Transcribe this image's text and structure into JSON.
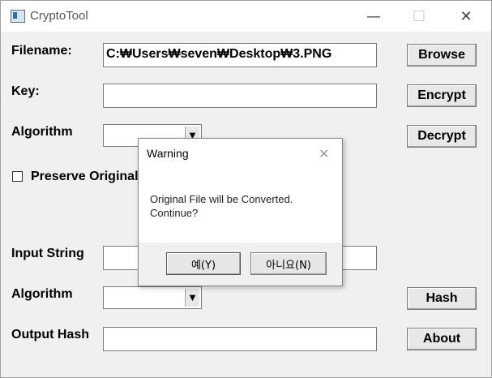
{
  "window": {
    "title": "CryptoTool",
    "minimize": "—",
    "maximize": "☐",
    "close": "✕"
  },
  "form": {
    "filename_label": "Filename:",
    "filename_value": "C:₩Users₩seven₩Desktop₩3.PNG",
    "key_label": "Key:",
    "key_value": "",
    "algorithm_label": "Algorithm",
    "preserve_label": "Preserve Original",
    "input_string_label": "Input String",
    "input_string_value": "",
    "hash_algorithm_label": "Algorithm",
    "output_hash_label": "Output Hash",
    "output_hash_value": ""
  },
  "buttons": {
    "browse": "Browse",
    "encrypt": "Encrypt",
    "decrypt": "Decrypt",
    "hash": "Hash",
    "about": "About"
  },
  "dialog": {
    "title": "Warning",
    "close": "✕",
    "message_line1": "Original File will be Converted.",
    "message_line2": "Continue?",
    "yes": "예(Y)",
    "no": "아니요(N)"
  },
  "icons": {
    "app": "app-window-icon",
    "dropdown": "▼"
  }
}
